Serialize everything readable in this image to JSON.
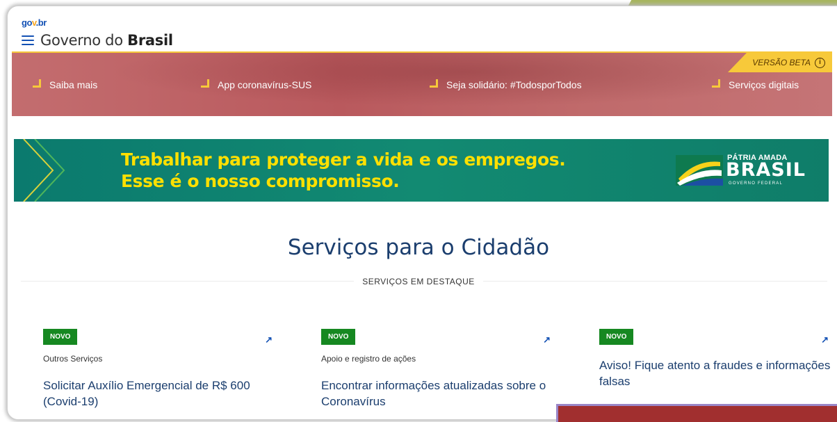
{
  "logo": {
    "g": "go",
    "o": "v",
    "rest": ".br"
  },
  "header": {
    "title_prefix": "Governo do",
    "title_bold": "Brasil"
  },
  "band": {
    "beta_label": "VERSÃO BETA",
    "beta_icon": "info-icon",
    "links": [
      "Saiba mais",
      "App coronavírus-SUS",
      "Seja solidário: #TodosporTodos",
      "Serviços digitais"
    ]
  },
  "banner": {
    "line1": "Trabalhar para proteger a vida e os empregos.",
    "line2": "Esse é o nosso compromisso.",
    "patria_top": "PÁTRIA AMADA",
    "patria_main": "BRASIL",
    "patria_bottom": "GOVERNO FEDERAL"
  },
  "services": {
    "title": "Serviços para o Cidadão",
    "subtitle": "SERVIÇOS EM DESTAQUE",
    "cards": [
      {
        "badge": "NOVO",
        "category": "Outros Serviços",
        "title": "Solicitar Auxílio Emergencial de R$ 600 (Covid-19)"
      },
      {
        "badge": "NOVO",
        "category": "Apoio e registro de ações",
        "title": "Encontrar informações atualizadas sobre o Coronavírus"
      },
      {
        "badge": "NOVO",
        "category": "",
        "title": "Aviso! Fique atento a fraudes e informações falsas"
      }
    ]
  },
  "colors": {
    "gov_blue": "#1351b4",
    "band_red": "#b9595d",
    "accent_yellow": "#f7c93a",
    "banner_green": "#128a72",
    "badge_green": "#168821"
  }
}
